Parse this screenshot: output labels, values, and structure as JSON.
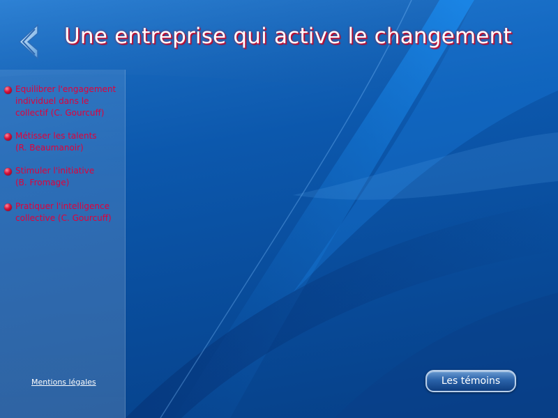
{
  "header": {
    "title": "Une entreprise qui active le changement",
    "back_icon": "chevron-left-icon"
  },
  "sidebar": {
    "items": [
      {
        "label": "Equilibrer l'engagement\nindividuel dans le\ncollectif (C. Gourcuff)"
      },
      {
        "label": "Métisser les talents\n(R. Beaumanoir)"
      },
      {
        "label": "Stimuler l'initiative\n(B. Fromage)"
      },
      {
        "label": "Pratiquer l'intelligence\ncollective (C. Gourcuff)"
      }
    ]
  },
  "footer": {
    "legal_link": "Mentions légales",
    "temoins_button": "Les témoins"
  },
  "colors": {
    "background_blue": "#0c58ad",
    "menu_text": "#e2003a",
    "title_shadow": "#c2143e"
  }
}
